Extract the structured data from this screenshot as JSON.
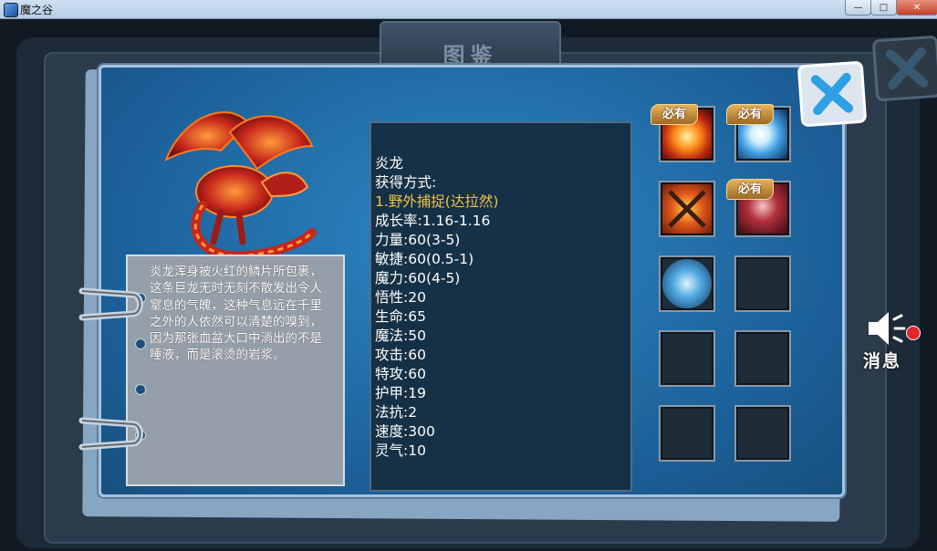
{
  "window": {
    "title": "魔之谷"
  },
  "tab": {
    "label": "图鉴"
  },
  "description": "炎龙浑身被火红的鳞片所包裹，这条巨龙无时无刻不散发出令人窒息的气魄，这种气息远在千里之外的人依然可以清楚的嗅到，因为那张血盆大口中淌出的不是唾液，而是滚烫的岩浆。",
  "stats": {
    "name": "炎龙",
    "obtain_label": "获得方式:",
    "obtain_method": "1.野外捕捉(达拉然)",
    "growth": "成长率:1.16-1.16",
    "strength": "力量:60(3-5)",
    "agility": "敏捷:60(0.5-1)",
    "magic": "魔力:60(4-5)",
    "wisdom": "悟性:20",
    "life": "生命:65",
    "mana": "魔法:50",
    "attack": "攻击:60",
    "special_attack": "特攻:60",
    "armor": "护甲:19",
    "resist": "法抗:2",
    "speed": "速度:300",
    "spirit": "灵气:10"
  },
  "skills": {
    "must_have_label": "必有"
  },
  "message": {
    "label": "消息"
  },
  "colors": {
    "accent_gold": "#f1c04b",
    "panel_blue": "#1c5f98",
    "notify_red": "#e0272c"
  },
  "icons": [
    "close-icon",
    "speaker-icon",
    "dragon-image"
  ]
}
